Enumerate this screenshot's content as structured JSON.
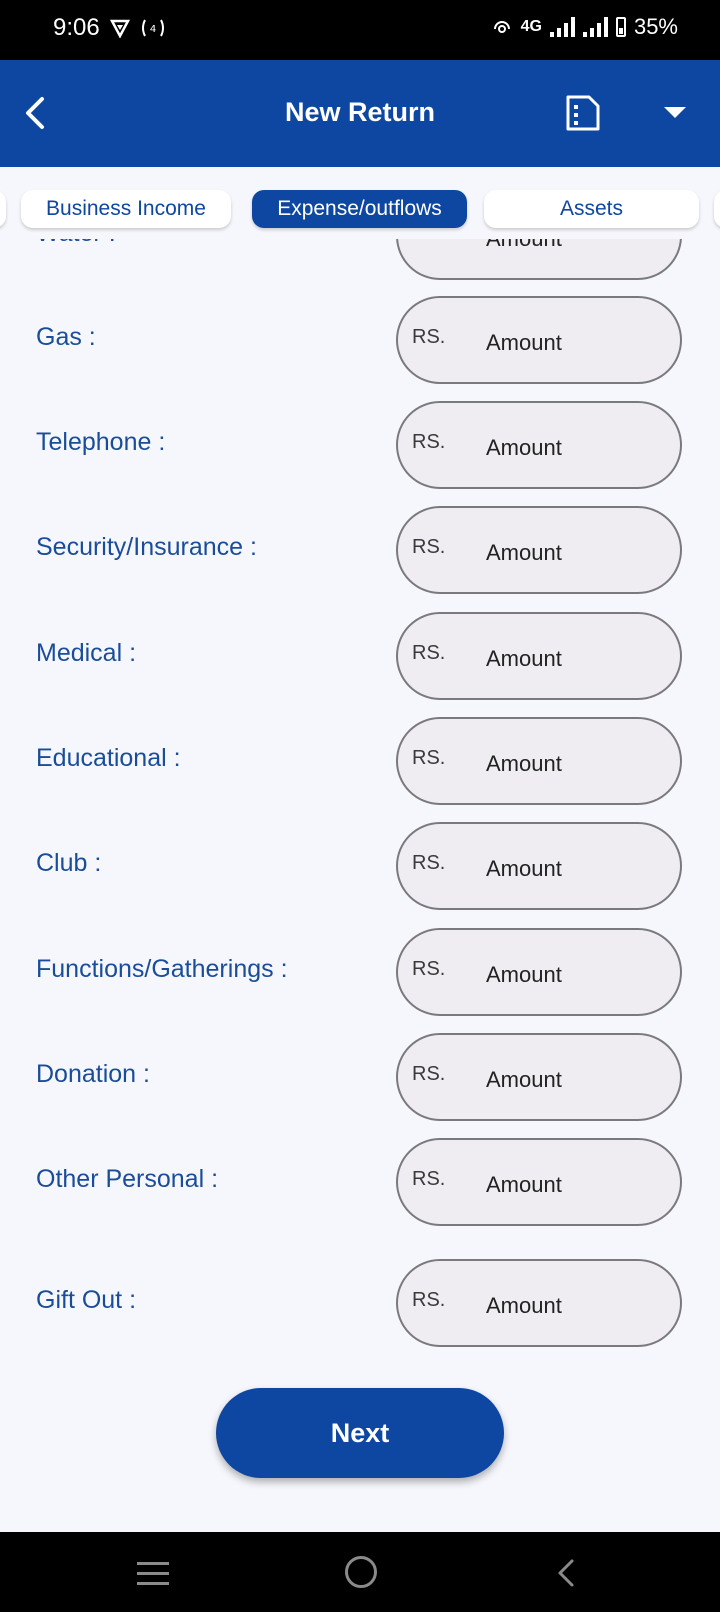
{
  "status_bar": {
    "time": "9:06",
    "network": "4G",
    "battery": "35%"
  },
  "app_bar": {
    "title": "New Return"
  },
  "tabs": [
    {
      "label": "Business Income",
      "active": false
    },
    {
      "label": "Expense/outflows",
      "active": true
    },
    {
      "label": "Assets",
      "active": false
    }
  ],
  "form": {
    "currency_prefix": "RS.",
    "placeholder": "Amount",
    "rows": [
      {
        "label": "Water :"
      },
      {
        "label": "Gas :"
      },
      {
        "label": "Telephone :"
      },
      {
        "label": "Security/Insurance :"
      },
      {
        "label": "Medical :"
      },
      {
        "label": "Educational :"
      },
      {
        "label": "Club :"
      },
      {
        "label": "Functions/Gatherings :"
      },
      {
        "label": "Donation :"
      },
      {
        "label": "Other Personal :"
      },
      {
        "label": "Gift Out :"
      }
    ]
  },
  "next_button": {
    "label": "Next"
  },
  "colors": {
    "primary": "#0e47a1",
    "label_text": "#1a4d99",
    "field_bg": "#efedf1",
    "field_border": "#7a797d",
    "page_bg": "#f6f7fc"
  }
}
